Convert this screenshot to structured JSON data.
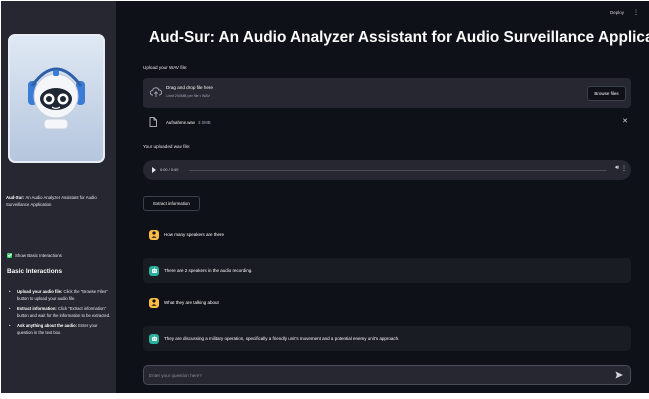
{
  "header": {
    "deploy_label": "Deploy",
    "menu_glyph": "⋮"
  },
  "title": "Aud-Sur: An Audio Analyzer Assistant for Audio Surveillance Application",
  "sidebar": {
    "logo_icon": "robot-headphones-logo",
    "app_name": "Aud-Sur:",
    "app_subtitle": "An Audio Analyzer Assistant for Audio Surveillance Application",
    "toggle_label": "Show Basic Interactions",
    "toggle_checked": true,
    "section_title": "Basic Interactions",
    "items": [
      {
        "bold": "Upload your audio file:",
        "text": "Click the \"Browse Files\" button to upload your audio file."
      },
      {
        "bold": "Extract information:",
        "text": "Click \"Extract information\" button and wait for the information to be extracted."
      },
      {
        "bold": "Ask anything about the audio:",
        "text": "Enter your question in the text box."
      }
    ]
  },
  "upload": {
    "label": "Upload your WAV file:",
    "drag_text": "Drag and drop file here",
    "limit_text": "Limit 200MB per file • WAV",
    "browse_label": "Browse files"
  },
  "file": {
    "name": "Aufnahme.wav",
    "size": "3.0MB"
  },
  "audio": {
    "label": "Your uploaded wav file:",
    "time": "0:00 / 0:40",
    "progress": 0
  },
  "extract_label": "Extract information",
  "chat": [
    {
      "role": "user",
      "text": "How many speakers are there"
    },
    {
      "role": "assistant",
      "text": "There are 2 speakers in the audio recording."
    },
    {
      "role": "user",
      "text": "What they are talking about"
    },
    {
      "role": "assistant",
      "text": "They are discussing a military operation, specifically a friendly unit's movement and a potential enemy unit's approach."
    }
  ],
  "chat_input": {
    "placeholder": "Enter your question here?",
    "value": ""
  },
  "colors": {
    "sidebar_bg": "#262730",
    "main_bg": "#0e1117",
    "user_avatar": "#ffbd45",
    "assistant_avatar": "#29b09d",
    "checkbox": "#3dd56d"
  }
}
